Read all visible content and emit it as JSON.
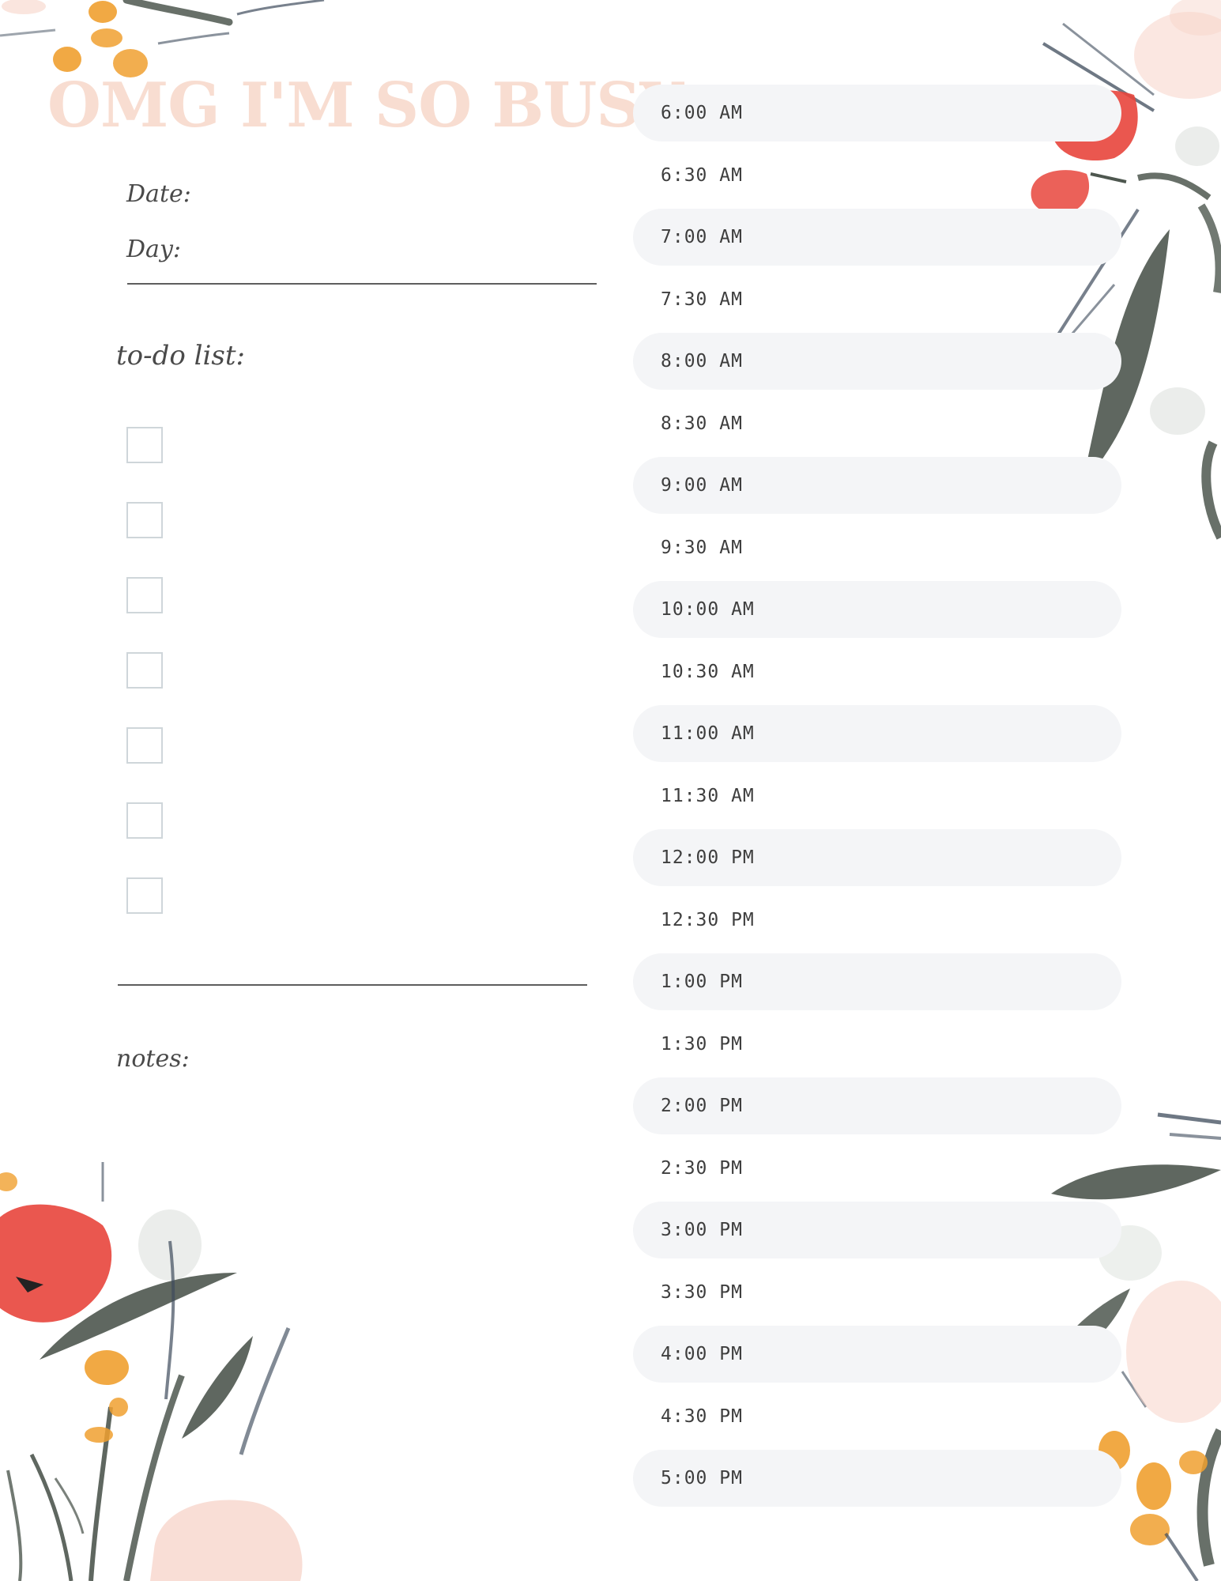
{
  "title": "OMG I'M SO BUSY",
  "labels": {
    "date": "Date:",
    "day": "Day:",
    "todo": "to-do list:",
    "notes": "notes:"
  },
  "todo_checkbox_count": 7,
  "schedule": [
    {
      "time": "6:00 AM",
      "shaded": true
    },
    {
      "time": "6:30 AM",
      "shaded": false
    },
    {
      "time": "7:00 AM",
      "shaded": true
    },
    {
      "time": "7:30 AM",
      "shaded": false
    },
    {
      "time": "8:00 AM",
      "shaded": true
    },
    {
      "time": "8:30 AM",
      "shaded": false
    },
    {
      "time": "9:00 AM",
      "shaded": true
    },
    {
      "time": "9:30 AM",
      "shaded": false
    },
    {
      "time": "10:00 AM",
      "shaded": true
    },
    {
      "time": "10:30 AM",
      "shaded": false
    },
    {
      "time": "11:00 AM",
      "shaded": true
    },
    {
      "time": "11:30 AM",
      "shaded": false
    },
    {
      "time": "12:00 PM",
      "shaded": true
    },
    {
      "time": "12:30 PM",
      "shaded": false
    },
    {
      "time": "1:00 PM",
      "shaded": true
    },
    {
      "time": "1:30 PM",
      "shaded": false
    },
    {
      "time": "2:00 PM",
      "shaded": true
    },
    {
      "time": "2:30 PM",
      "shaded": false
    },
    {
      "time": "3:00 PM",
      "shaded": true
    },
    {
      "time": "3:30 PM",
      "shaded": false
    },
    {
      "time": "4:00 PM",
      "shaded": true
    },
    {
      "time": "4:30 PM",
      "shaded": false
    },
    {
      "time": "5:00 PM",
      "shaded": true
    }
  ],
  "colors": {
    "title": "#f8ddd1",
    "slot_shade": "#f4f5f7",
    "poppy_red": "#e8453c",
    "blossom_pink": "#f7d3c8",
    "flower_orange": "#f0a030",
    "leaf_green": "#4e574f",
    "stem_navy": "#3e4b5c"
  },
  "decorations": [
    "floral-top-left",
    "floral-top-right",
    "floral-mid-right",
    "floral-bottom-left",
    "floral-bottom-right"
  ]
}
